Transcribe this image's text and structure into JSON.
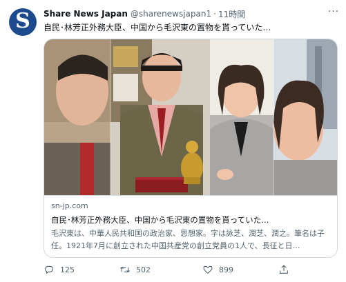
{
  "tweet": {
    "avatar_letter": "S",
    "display_name": "Share News Japan",
    "handle": "@sharenewsjapan1",
    "separator": "·",
    "time": "11時間",
    "text": "自民･林芳正外務大臣、中国から毛沢東の置物を貰っていた…"
  },
  "card": {
    "domain": "sn-jp.com",
    "title": "自民･林芳正外務大臣、中国から毛沢東の置物を貰っていた…",
    "description": "毛沢東は、中華人民共和国の政治家、思想家。字は詠芝、潤芝、潤之。筆名は子任。1921年7月に創立された中国共産党の創立党員の1人で、長征と日…"
  },
  "actions": {
    "reply_count": "125",
    "retweet_count": "502",
    "like_count": "899"
  },
  "icons": [
    "more-icon",
    "reply-icon",
    "retweet-icon",
    "like-icon",
    "share-icon"
  ],
  "colors": {
    "avatar_bg": "#1d4a8c",
    "secondary_text": "#536471",
    "border": "#cfd9de"
  }
}
